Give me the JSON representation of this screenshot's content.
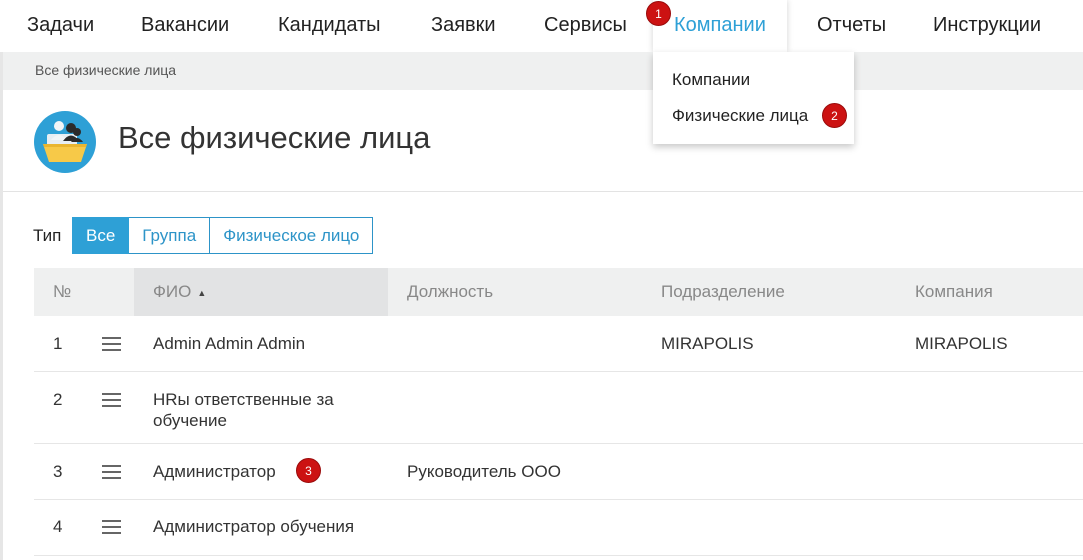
{
  "nav": {
    "items": [
      {
        "label": "Задачи"
      },
      {
        "label": "Вакансии"
      },
      {
        "label": "Кандидаты"
      },
      {
        "label": "Заявки"
      },
      {
        "label": "Сервисы"
      },
      {
        "label": "Компании"
      },
      {
        "label": "Отчеты"
      },
      {
        "label": "Инструкции"
      }
    ]
  },
  "dropdown": {
    "items": [
      {
        "label": "Компании"
      },
      {
        "label": "Физические лица"
      }
    ]
  },
  "breadcrumb": "Все физические лица",
  "page": {
    "title": "Все физические лица",
    "icon": "people-folder-icon"
  },
  "filter": {
    "label": "Тип",
    "options": [
      {
        "label": "Все"
      },
      {
        "label": "Группа"
      },
      {
        "label": "Физическое лицо"
      }
    ],
    "selected": "Все"
  },
  "table": {
    "columns": [
      "№",
      "ФИО",
      "Должность",
      "Подразделение",
      "Компания"
    ],
    "sort_column": "ФИО",
    "sort_direction": "asc",
    "rows": [
      {
        "num": "1",
        "name": "Admin Admin Admin",
        "position": "",
        "department": "MIRAPOLIS",
        "company": "MIRAPOLIS"
      },
      {
        "num": "2",
        "name": "HRы ответственные за обучение",
        "position": "",
        "department": "",
        "company": ""
      },
      {
        "num": "3",
        "name": "Администратор",
        "position": "Руководитель ООО",
        "department": "",
        "company": ""
      },
      {
        "num": "4",
        "name": "Администратор обучения",
        "position": "",
        "department": "",
        "company": ""
      }
    ]
  },
  "badges": [
    "1",
    "2",
    "3"
  ],
  "colors": {
    "accent": "#2ea0d6",
    "badge": "#cc1212",
    "header_bg": "#eff0f0"
  }
}
